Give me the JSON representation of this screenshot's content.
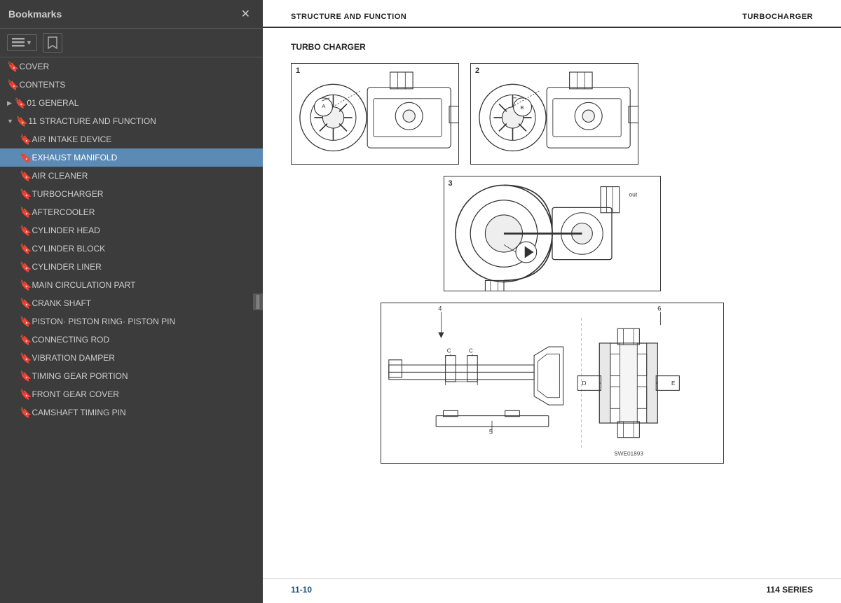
{
  "sidebar": {
    "title": "Bookmarks",
    "close_label": "✕",
    "toolbar": {
      "view_btn_icon": "☰",
      "bookmark_btn_icon": "🔖"
    },
    "items": [
      {
        "id": "cover",
        "label": "COVER",
        "level": 1,
        "expanded": false,
        "active": false
      },
      {
        "id": "contents",
        "label": "CONTENTS",
        "level": 1,
        "expanded": false,
        "active": false
      },
      {
        "id": "01-general",
        "label": "01 GENERAL",
        "level": 1,
        "expanded": false,
        "active": false,
        "has_children": true
      },
      {
        "id": "11-structure",
        "label": "11 STRACTURE AND FUNCTION",
        "level": 1,
        "expanded": true,
        "active": false,
        "has_children": true
      },
      {
        "id": "air-intake",
        "label": "AIR INTAKE DEVICE",
        "level": 2,
        "active": false
      },
      {
        "id": "exhaust-manifold",
        "label": "EXHAUST MANIFOLD",
        "level": 2,
        "active": true
      },
      {
        "id": "air-cleaner",
        "label": "AIR CLEANER",
        "level": 2,
        "active": false
      },
      {
        "id": "turbocharger",
        "label": "TURBOCHARGER",
        "level": 2,
        "active": false
      },
      {
        "id": "aftercooler",
        "label": "AFTERCOOLER",
        "level": 2,
        "active": false
      },
      {
        "id": "cylinder-head",
        "label": "CYLINDER HEAD",
        "level": 2,
        "active": false
      },
      {
        "id": "cylinder-block",
        "label": "CYLINDER BLOCK",
        "level": 2,
        "active": false
      },
      {
        "id": "cylinder-liner",
        "label": "CYLINDER LINER",
        "level": 2,
        "active": false
      },
      {
        "id": "main-circulation",
        "label": "MAIN CIRCULATION PART",
        "level": 2,
        "active": false
      },
      {
        "id": "crank-shaft",
        "label": "CRANK SHAFT",
        "level": 2,
        "active": false
      },
      {
        "id": "piston-ring",
        "label": "PISTON· PISTON RING· PISTON PIN",
        "level": 2,
        "active": false
      },
      {
        "id": "connecting-rod",
        "label": "CONNECTING ROD",
        "level": 2,
        "active": false
      },
      {
        "id": "vibration-damper",
        "label": "VIBRATION DAMPER",
        "level": 2,
        "active": false
      },
      {
        "id": "timing-gear",
        "label": "TIMING GEAR PORTION",
        "level": 2,
        "active": false
      },
      {
        "id": "front-gear-cover",
        "label": "FRONT GEAR COVER",
        "level": 2,
        "active": false
      },
      {
        "id": "camshaft-timing",
        "label": "CAMSHAFT TIMING PIN",
        "level": 2,
        "active": false
      }
    ]
  },
  "main": {
    "header_left": "STRUCTURE AND FUNCTION",
    "header_right": "TURBOCHARGER",
    "section_title": "TURBO CHARGER",
    "ref_code": "SWE01893",
    "page_number": "11-10",
    "series": "114 SERIES",
    "diagrams": [
      {
        "number": "1"
      },
      {
        "number": "2"
      },
      {
        "number": "3"
      },
      {
        "number": "4-5-6"
      }
    ]
  }
}
